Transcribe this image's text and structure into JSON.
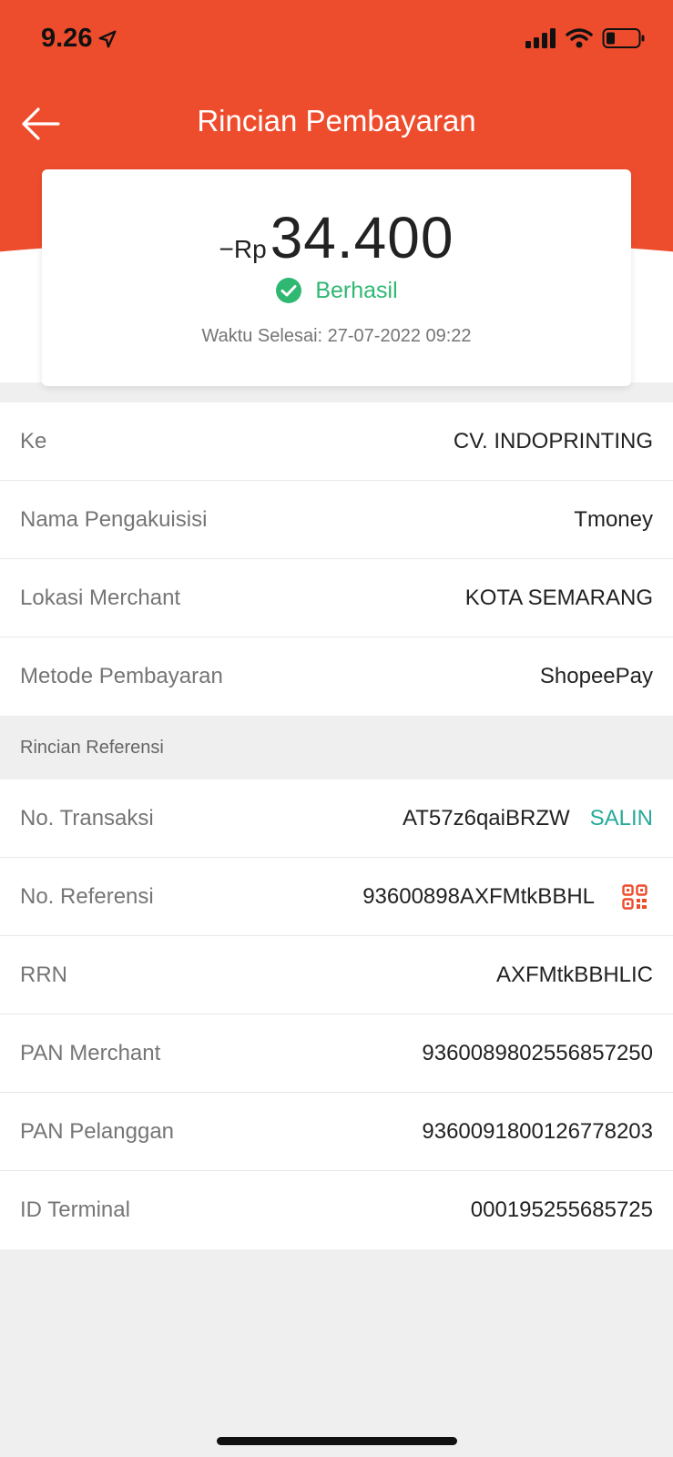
{
  "status_bar": {
    "time": "9.26",
    "icons": [
      "location-arrow-icon",
      "signal-icon",
      "wifi-icon",
      "battery-icon"
    ]
  },
  "nav": {
    "title": "Rincian Pembayaran",
    "back_icon": "arrow-left-icon"
  },
  "summary": {
    "amount_prefix": "−Rp",
    "amount": "34.400",
    "status": "Berhasil",
    "finish_time": "Waktu Selesai: 27-07-2022 09:22"
  },
  "details": [
    {
      "label": "Ke",
      "value": "CV. INDOPRINTING"
    },
    {
      "label": "Nama Pengakuisisi",
      "value": "Tmoney"
    },
    {
      "label": "Lokasi Merchant",
      "value": "KOTA SEMARANG"
    },
    {
      "label": "Metode Pembayaran",
      "value": "ShopeePay"
    }
  ],
  "reference_section": {
    "title": "Rincian Referensi"
  },
  "references": [
    {
      "label": "No. Transaksi",
      "value": "AT57z6qaiBRZW",
      "action": "SALIN"
    },
    {
      "label": "No. Referensi",
      "value": "93600898AXFMtkBBHL",
      "action_icon": "qr-code-icon"
    },
    {
      "label": "RRN",
      "value": "AXFMtkBBHLIC"
    },
    {
      "label": "PAN Merchant",
      "value": "9360089802556857250"
    },
    {
      "label": "PAN Pelanggan",
      "value": "9360091800126778203"
    },
    {
      "label": "ID Terminal",
      "value": "000195255685725"
    }
  ],
  "colors": {
    "brand": "#ee4d2d",
    "success": "#2fb872",
    "copy": "#26aa99"
  }
}
